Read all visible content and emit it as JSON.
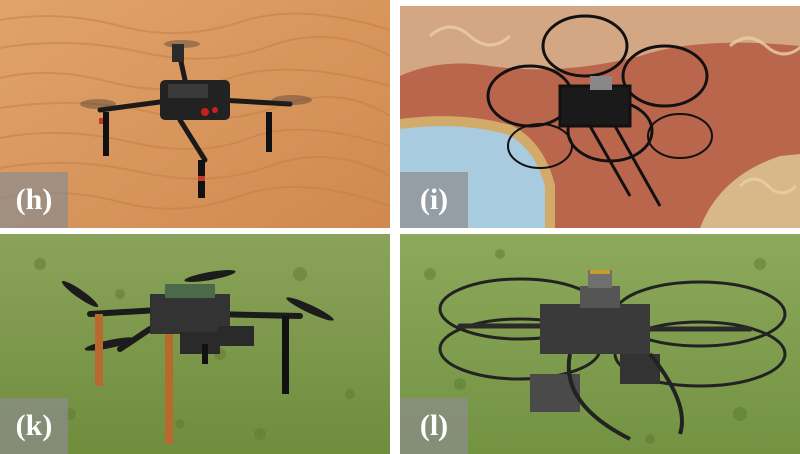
{
  "panels": [
    {
      "id": "h",
      "label": "(h)"
    },
    {
      "id": "i",
      "label": "(i)"
    },
    {
      "id": "k",
      "label": "(k)"
    },
    {
      "id": "l",
      "label": "(l)"
    }
  ],
  "colors": {
    "sand": "#d9965a",
    "fresco_red": "#b5624a",
    "fresco_blue": "#a9cbe0",
    "grass": "#7f9a4a",
    "drone_black": "#1c1c1c",
    "leg_orange": "#b8692e",
    "label_bg": "#8c8c8c"
  }
}
